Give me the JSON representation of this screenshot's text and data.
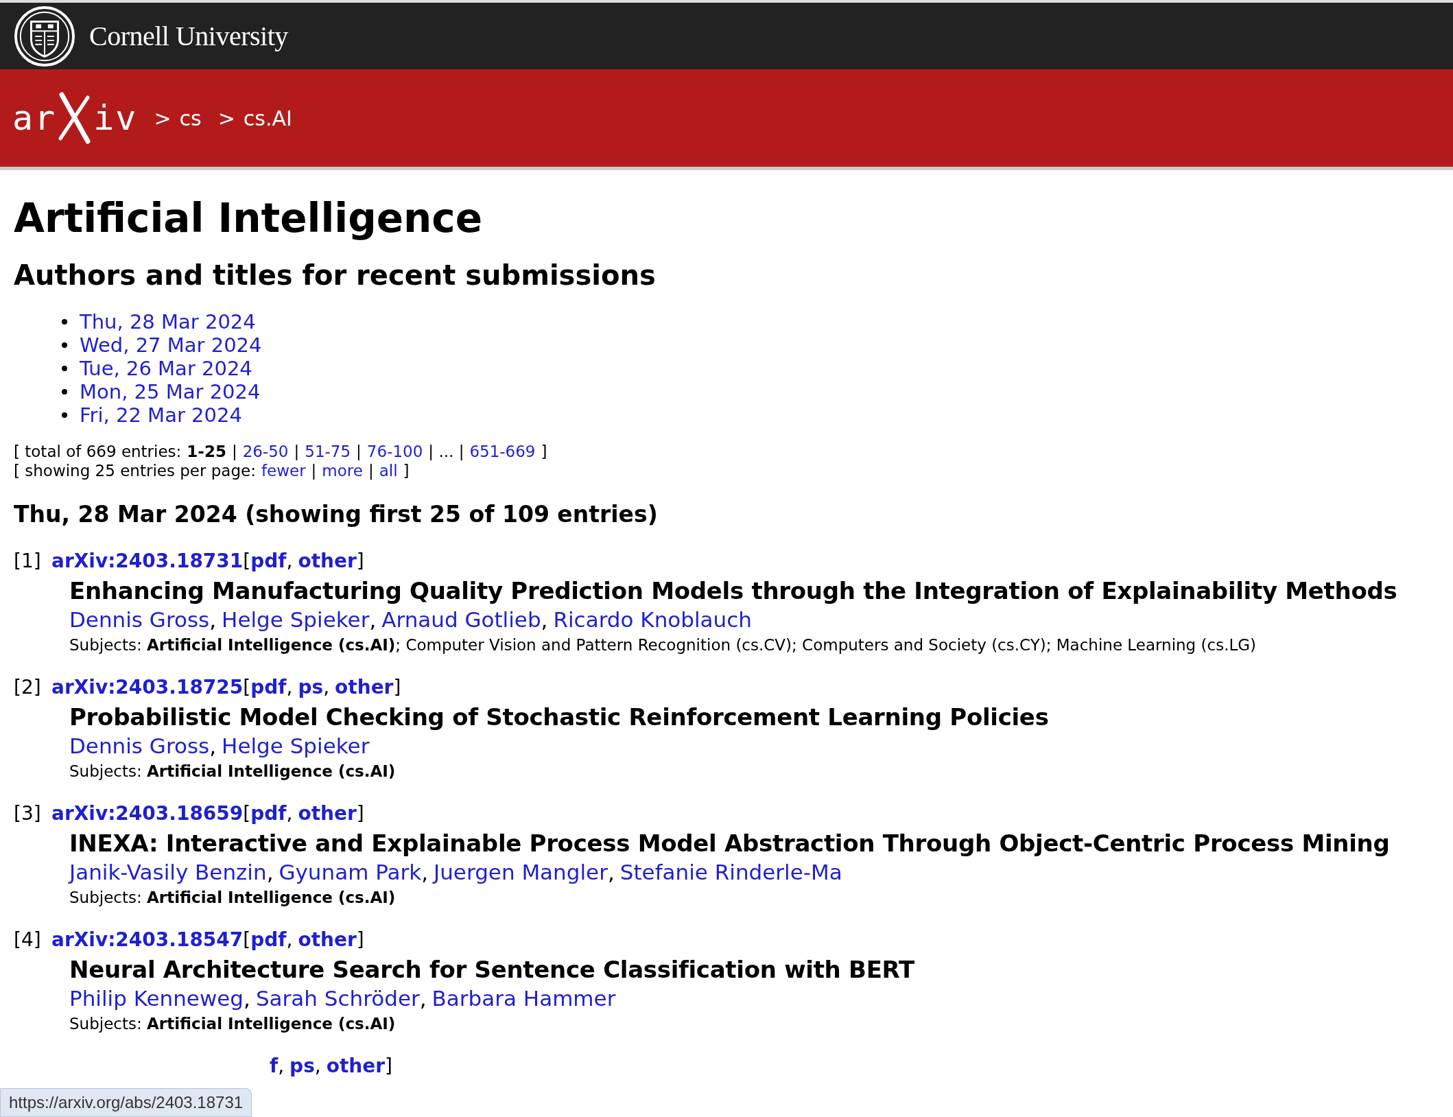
{
  "header": {
    "institution": "Cornell University"
  },
  "banner": {
    "logo_left": "ar",
    "logo_right": "iv",
    "breadcrumb": [
      {
        "sep": ">",
        "label": "cs"
      },
      {
        "sep": ">",
        "label": "cs.AI"
      }
    ]
  },
  "title": "Artificial Intelligence",
  "subtitle": "Authors and titles for recent submissions",
  "dates": [
    "Thu, 28 Mar 2024",
    "Wed, 27 Mar 2024",
    "Tue, 26 Mar 2024",
    "Mon, 25 Mar 2024",
    "Fri, 22 Mar 2024"
  ],
  "pagination": [
    [
      {
        "kind": "text",
        "text": "[ total of 669 entries:"
      },
      {
        "kind": "current",
        "text": "1-25"
      },
      {
        "kind": "text",
        "text": "|"
      },
      {
        "kind": "link",
        "text": "26-50"
      },
      {
        "kind": "text",
        "text": "|"
      },
      {
        "kind": "link",
        "text": "51-75"
      },
      {
        "kind": "text",
        "text": "|"
      },
      {
        "kind": "link",
        "text": "76-100"
      },
      {
        "kind": "text",
        "text": "| ... |"
      },
      {
        "kind": "link",
        "text": "651-669"
      },
      {
        "kind": "text",
        "text": "]"
      }
    ],
    [
      {
        "kind": "text",
        "text": "[ showing 25 entries per page:"
      },
      {
        "kind": "link",
        "text": "fewer"
      },
      {
        "kind": "text",
        "text": "|"
      },
      {
        "kind": "link",
        "text": "more"
      },
      {
        "kind": "text",
        "text": "|"
      },
      {
        "kind": "link",
        "text": "all"
      },
      {
        "kind": "text",
        "text": "]"
      }
    ]
  ],
  "day_heading": "Thu, 28 Mar 2024 (showing first 25 of 109 entries)",
  "separator": ",",
  "open_bracket": "[",
  "close_bracket": "]",
  "entries": [
    {
      "kind": "full",
      "number": "[1]",
      "id": "arXiv:2403.18731",
      "formats": [
        "pdf",
        "other"
      ],
      "title": "Enhancing Manufacturing Quality Prediction Models through the Integration of Explainability Methods",
      "authors": [
        "Dennis Gross",
        "Helge Spieker",
        "Arnaud Gotlieb",
        "Ricardo Knoblauch"
      ],
      "subjects": "Subjects: **Artificial Intelligence (cs.AI)**; Computer Vision and Pattern Recognition (cs.CV); Computers and Society (cs.CY); Machine Learning (cs.LG)"
    },
    {
      "kind": "full",
      "number": "[2]",
      "id": "arXiv:2403.18725",
      "formats": [
        "pdf",
        "ps",
        "other"
      ],
      "title": "Probabilistic Model Checking of Stochastic Reinforcement Learning Policies",
      "authors": [
        "Dennis Gross",
        "Helge Spieker"
      ],
      "subjects": "Subjects: **Artificial Intelligence (cs.AI)**"
    },
    {
      "kind": "full",
      "number": "[3]",
      "id": "arXiv:2403.18659",
      "formats": [
        "pdf",
        "other"
      ],
      "title": "INEXA: Interactive and Explainable Process Model Abstraction Through Object-Centric Process Mining",
      "authors": [
        "Janik-Vasily Benzin",
        "Gyunam Park",
        "Juergen Mangler",
        "Stefanie Rinderle-Ma"
      ],
      "subjects": "Subjects: **Artificial Intelligence (cs.AI)**"
    },
    {
      "kind": "full",
      "number": "[4]",
      "id": "arXiv:2403.18547",
      "formats": [
        "pdf",
        "other"
      ],
      "title": "Neural Architecture Search for Sentence Classification with BERT",
      "authors": [
        "Philip Kenneweg",
        "Sarah Schröder",
        "Barbara Hammer"
      ],
      "subjects": "Subjects: **Artificial Intelligence (cs.AI)**"
    },
    {
      "kind": "partial",
      "formats": [
        "f",
        "ps",
        "other"
      ]
    }
  ],
  "status_tooltip": "https://arxiv.org/abs/2403.18731"
}
